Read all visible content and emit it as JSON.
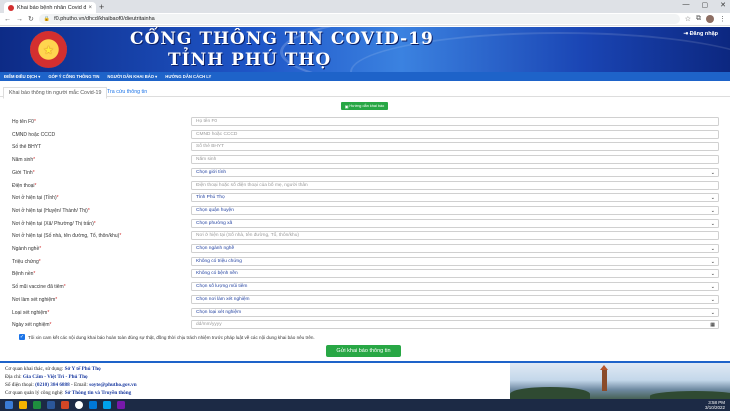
{
  "browser": {
    "tab_title": "Khai báo bệnh nhân Covid điều...",
    "url": "f0.phutho.vn/dhcd/khaibaof0/dieutritainha",
    "new_tab": "+",
    "win_min": "—",
    "win_max": "▢",
    "win_close": "✕",
    "lock": "🔒"
  },
  "banner": {
    "title_line1": "CỔNG THÔNG TIN COVID-19",
    "title_line2": "TỈNH PHÚ THỌ",
    "login": "Đăng nhập",
    "login_icon": "⇥"
  },
  "nav": {
    "items": [
      "ĐIỂM ĐIỀU DỊCH ▾",
      "GÓP Ý CỔNG THÔNG TIN",
      "NGƯỜI DÂN KHAI BÁO ▾",
      "HƯỚNG DẪN CÁCH LY"
    ]
  },
  "tabs": {
    "active": "Khai báo thông tin người mắc Covid-19",
    "lookup": "Tra cứu thông tin"
  },
  "guide_button": "Hướng dẫn khai báo",
  "form": {
    "fields": [
      {
        "label": "Họ tên F0",
        "req": "*",
        "value": "Họ tên F0",
        "type": "text"
      },
      {
        "label": "CMND hoặc CCCD",
        "req": "",
        "value": "CMND hoặc CCCD",
        "type": "text"
      },
      {
        "label": "Số thẻ BHYT",
        "req": "",
        "value": "Số thẻ BHYT",
        "type": "text"
      },
      {
        "label": "Năm sinh",
        "req": "*",
        "value": "Năm sinh",
        "type": "text"
      },
      {
        "label": "Giới Tính",
        "req": "*",
        "value": "Chọn giới tính",
        "type": "select"
      },
      {
        "label": "Điện thoại",
        "req": "*",
        "value": "Điện thoại hoặc số điện thoại của bố mẹ, người thân",
        "type": "text"
      },
      {
        "label": "Nơi ở hiện tại (Tỉnh)",
        "req": "*",
        "value": "Tỉnh Phú Thọ",
        "type": "select"
      },
      {
        "label": "Nơi ở hiện tại (Huyện/ Thành/ Thị)",
        "req": "*",
        "value": "Chọn quận huyện",
        "type": "select"
      },
      {
        "label": "Nơi ở hiện tại (Xã/ Phường/ Thị trấn)",
        "req": "*",
        "value": "Chọn phường xã",
        "type": "select"
      },
      {
        "label": "Nơi ở hiện tại (Số nhà, tên đường, Tổ, thôn/khu)",
        "req": "*",
        "value": "Nơi ở hiện tại (Số nhà, tên đường, Tổ, thôn/khu)",
        "type": "text"
      },
      {
        "label": "Ngành nghề",
        "req": "*",
        "value": "Chọn ngành nghề",
        "type": "select"
      },
      {
        "label": "Triệu chứng",
        "req": "*",
        "value": "Không có triệu chứng",
        "type": "select"
      },
      {
        "label": "Bệnh nền",
        "req": "*",
        "value": "Không có bệnh nền",
        "type": "select"
      },
      {
        "label": "Số mũi vaccine đã tiêm",
        "req": "*",
        "value": "Chọn số lượng mũi tiêm",
        "type": "select"
      },
      {
        "label": "Nơi làm xét nghiệm",
        "req": "*",
        "value": "Chọn nơi làm xét nghiệm",
        "type": "select"
      },
      {
        "label": "Loại xét nghiệm",
        "req": "*",
        "value": "Chọn loại xét nghiệm",
        "type": "select"
      },
      {
        "label": "Ngày xét nghiệm",
        "req": "*",
        "value": "dd/mm/yyyy",
        "type": "date"
      }
    ],
    "consent": "Tôi xin cam kết các nội dung khai báo hoàn toàn đúng sự thật, đồng thời chịu trách nhiệm trước pháp luật về các nội dung khai báo nêu trên.",
    "submit": "Gửi khai báo thông tin"
  },
  "footer": {
    "l1a": "Cơ quan khai thác, sử dụng: ",
    "l1b": "Sở Y tế Phú Thọ",
    "l2a": "Địa chỉ: ",
    "l2b": "Gia Cẩm - Việt Trì - Phú Thọ",
    "l3a": "Số điện thoại: ",
    "l3b": "(0210) 384 6888",
    "l3c": " - Email: ",
    "l3d": "soyte@phutho.gov.vn",
    "l4a": "Cơ quan quản lý công nghệ: ",
    "l4b": "Sở Thông tin và Truyền thông"
  },
  "taskbar": {
    "time": "3:58 PM",
    "date": "3/10/2022"
  }
}
